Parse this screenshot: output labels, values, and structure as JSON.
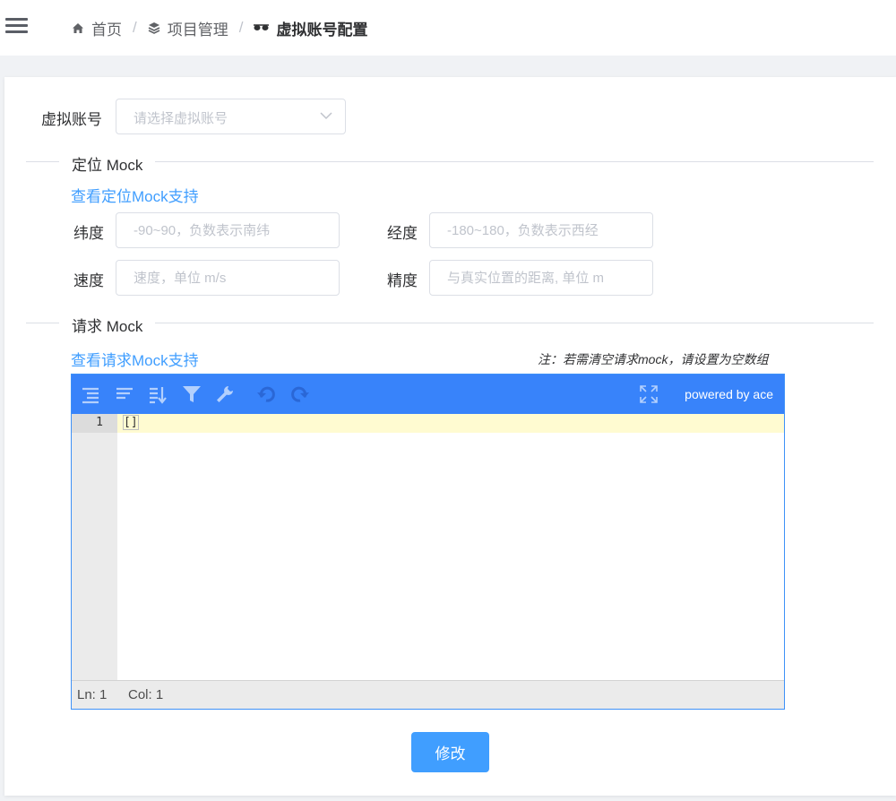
{
  "header": {
    "breadcrumb": [
      {
        "label": "首页",
        "icon": "home-icon"
      },
      {
        "label": "项目管理",
        "icon": "layers-icon"
      },
      {
        "label": "虚拟账号配置",
        "icon": "glasses-icon"
      }
    ],
    "separator": "/"
  },
  "form": {
    "account_label": "虚拟账号",
    "account_placeholder": "请选择虚拟账号",
    "location_section": "定位 Mock",
    "location_link": "查看定位Mock支持",
    "latitude_label": "纬度",
    "latitude_placeholder": "-90~90，负数表示南纬",
    "longitude_label": "经度",
    "longitude_placeholder": "-180~180，负数表示西经",
    "speed_label": "速度",
    "speed_placeholder": "速度，单位 m/s",
    "accuracy_label": "精度",
    "accuracy_placeholder": "与真实位置的距离, 单位 m",
    "request_section": "请求 Mock",
    "request_link": "查看请求Mock支持",
    "request_note": "注：若需清空请求mock，请设置为空数组",
    "submit_label": "修改"
  },
  "editor": {
    "powered_by": "powered by ace",
    "line_number": "1",
    "content": "[]",
    "status_line": "Ln: 1",
    "status_col": "Col: 1",
    "toolbar_color": "#3883fa"
  },
  "colors": {
    "primary": "#409eff",
    "link": "#409eff"
  }
}
